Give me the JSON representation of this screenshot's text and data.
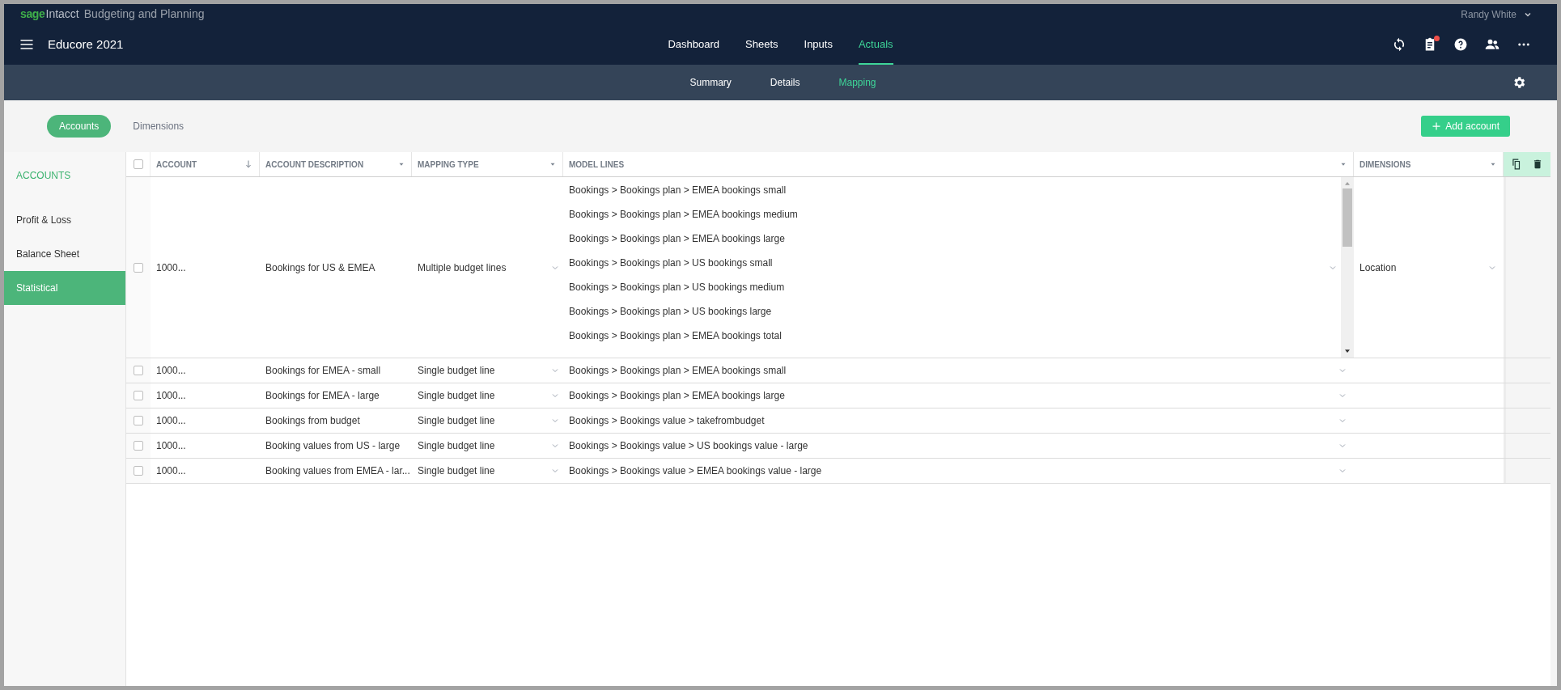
{
  "brand": {
    "logo": "sage",
    "product": "Intacct",
    "subtitle": "Budgeting and Planning"
  },
  "user": {
    "name": "Randy White"
  },
  "app_title": "Educore 2021",
  "nav_tabs": [
    {
      "label": "Dashboard",
      "selected": false
    },
    {
      "label": "Sheets",
      "selected": false
    },
    {
      "label": "Inputs",
      "selected": false
    },
    {
      "label": "Actuals",
      "selected": true
    }
  ],
  "sub_tabs": [
    {
      "label": "Summary",
      "selected": false
    },
    {
      "label": "Details",
      "selected": false
    },
    {
      "label": "Mapping",
      "selected": true
    }
  ],
  "view_tabs": [
    {
      "label": "Accounts",
      "selected": true
    },
    {
      "label": "Dimensions",
      "selected": false
    }
  ],
  "add_button": {
    "label": "Add account"
  },
  "sidebar": {
    "heading": "ACCOUNTS",
    "items": [
      {
        "label": "Profit & Loss",
        "selected": false
      },
      {
        "label": "Balance Sheet",
        "selected": false
      },
      {
        "label": "Statistical",
        "selected": true
      }
    ]
  },
  "table": {
    "select_all": {
      "checked": false
    },
    "columns": [
      {
        "label": "ACCOUNT",
        "kind": "sort"
      },
      {
        "label": "ACCOUNT DESCRIPTION",
        "kind": "menu"
      },
      {
        "label": "MAPPING TYPE",
        "kind": "menu"
      },
      {
        "label": "MODEL LINES",
        "kind": "menu"
      },
      {
        "label": "DIMENSIONS",
        "kind": "menu"
      }
    ],
    "rows": [
      {
        "checked": false,
        "account": "1000...",
        "description": "Bookings for US & EMEA",
        "mapping_type": "Multiple budget lines",
        "model_lines": [
          "Bookings > Bookings plan > EMEA bookings small",
          "Bookings > Bookings plan > EMEA bookings medium",
          "Bookings > Bookings plan > EMEA bookings large",
          "Bookings > Bookings plan > US bookings small",
          "Bookings > Bookings plan > US bookings medium",
          "Bookings > Bookings plan > US bookings large",
          "Bookings > Bookings plan > EMEA bookings total"
        ],
        "dimensions": "Location"
      },
      {
        "checked": false,
        "account": "1000...",
        "description": "Bookings for EMEA - small",
        "mapping_type": "Single budget line",
        "model_lines": [
          "Bookings > Bookings plan > EMEA bookings small"
        ]
      },
      {
        "checked": false,
        "account": "1000...",
        "description": "Bookings for EMEA - large",
        "mapping_type": "Single budget line",
        "model_lines": [
          "Bookings > Bookings plan > EMEA bookings large"
        ]
      },
      {
        "checked": false,
        "account": "1000...",
        "description": "Bookings from budget",
        "mapping_type": "Single budget line",
        "model_lines": [
          "Bookings > Bookings value > takefrombudget"
        ]
      },
      {
        "checked": false,
        "account": "1000...",
        "description": "Booking values from US - large",
        "mapping_type": "Single budget line",
        "model_lines": [
          "Bookings > Bookings value > US bookings value - large"
        ]
      },
      {
        "checked": false,
        "account": "1000...",
        "description": "Booking values from EMEA - lar...",
        "mapping_type": "Single budget line",
        "model_lines": [
          "Bookings > Bookings value > EMEA bookings value - large"
        ]
      }
    ]
  }
}
